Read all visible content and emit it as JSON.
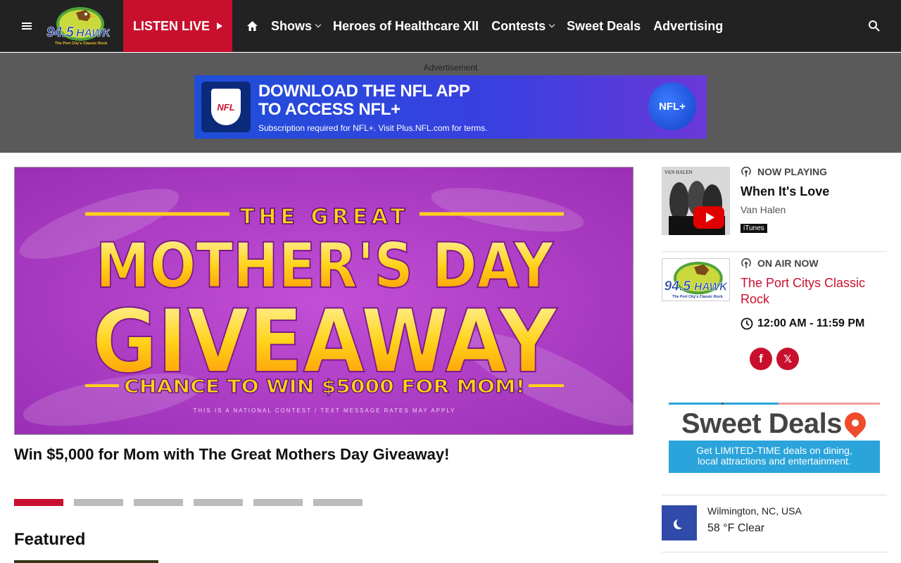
{
  "nav": {
    "logo_text": "94.5 The HAWK",
    "logo_tagline": "The Port City's Classic Rock",
    "listen_live": "LISTEN LIVE",
    "links": [
      {
        "label": "Shows",
        "dropdown": true
      },
      {
        "label": "Heroes of Healthcare XII",
        "dropdown": false
      },
      {
        "label": "Contests",
        "dropdown": true
      },
      {
        "label": "Sweet Deals",
        "dropdown": false
      },
      {
        "label": "Advertising",
        "dropdown": false
      }
    ]
  },
  "ad": {
    "label": "Advertisement",
    "headline_1": "DOWNLOAD THE NFL APP",
    "headline_2": "TO ACCESS NFL+",
    "subtext": "Subscription required for NFL+. Visit Plus.NFL.com for terms.",
    "shield_text": "NFL",
    "badge_text": "NFL+"
  },
  "hero": {
    "image_top": "THE GREAT",
    "image_line_1": "MOTHER'S DAY",
    "image_line_2": "GIVEAWAY",
    "image_bottom": "CHANCE TO WIN $5000 FOR MOM!",
    "image_fine": "THIS IS A NATIONAL CONTEST / TEXT MESSAGE RATES MAY APPLY",
    "caption": "Win $5,000 for Mom with The Great Mothers Day Giveaway!",
    "slide_count": 6,
    "active_slide": 1
  },
  "featured_heading": "Featured",
  "now_playing": {
    "label": "NOW PLAYING",
    "album_caption": "VAN HALEN",
    "song": "When It's Love",
    "artist": "Van Halen",
    "store": "iTunes"
  },
  "on_air": {
    "label": "ON AIR NOW",
    "show": "The Port Citys Classic Rock",
    "time": "12:00 AM - 11:59 PM"
  },
  "social": {
    "facebook": "f",
    "x": "𝕏"
  },
  "sweet_deals": {
    "title": "Sweet Deals",
    "sub_line_1": "Get LIMITED-TIME deals on dining,",
    "sub_line_2": "local attractions and entertainment."
  },
  "weather": {
    "location": "Wilmington, NC, USA",
    "temp": "58 °F Clear"
  },
  "colors": {
    "brand_red": "#c8102e",
    "nav_bg": "#222222",
    "ad_blue": "#1e4fd8",
    "hero_purple": "#b13ec9"
  }
}
